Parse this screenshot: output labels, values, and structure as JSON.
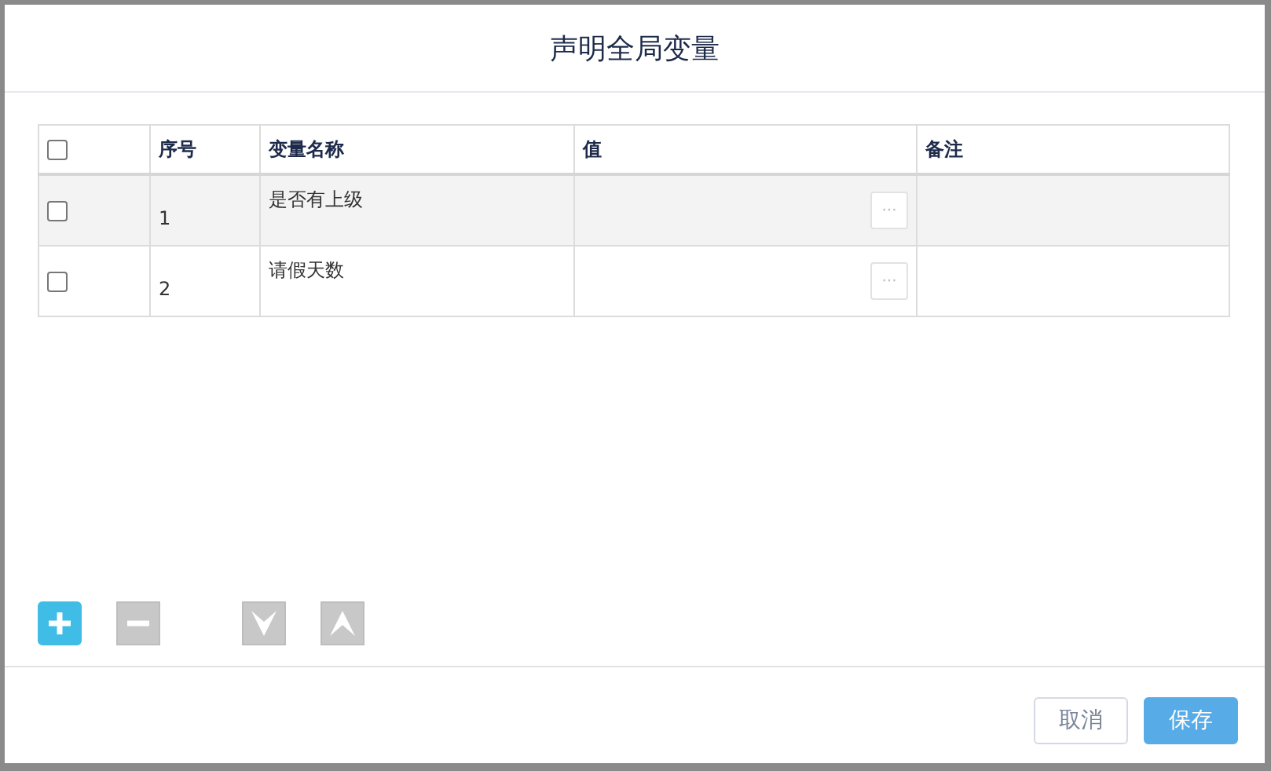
{
  "dialog": {
    "title": "声明全局变量"
  },
  "table": {
    "select_all": {
      "checked": false
    },
    "columns": [
      "序号",
      "变量名称",
      "值",
      "备注"
    ],
    "rows": [
      {
        "checked": false,
        "highlighted": true,
        "index": "1",
        "name": "是否有上级",
        "value_button": "···"
      },
      {
        "checked": false,
        "highlighted": false,
        "index": "2",
        "name": "请假天数",
        "value_button": "···"
      }
    ]
  },
  "toolbar": [
    {
      "kind": "add",
      "disabled": false
    },
    {
      "kind": "remove",
      "disabled": true
    },
    {
      "kind": "down",
      "disabled": true
    },
    {
      "kind": "up",
      "disabled": true
    }
  ],
  "buttons": [
    {
      "label": "取消",
      "kind": "secondary"
    },
    {
      "label": "保存",
      "kind": "primary"
    }
  ]
}
